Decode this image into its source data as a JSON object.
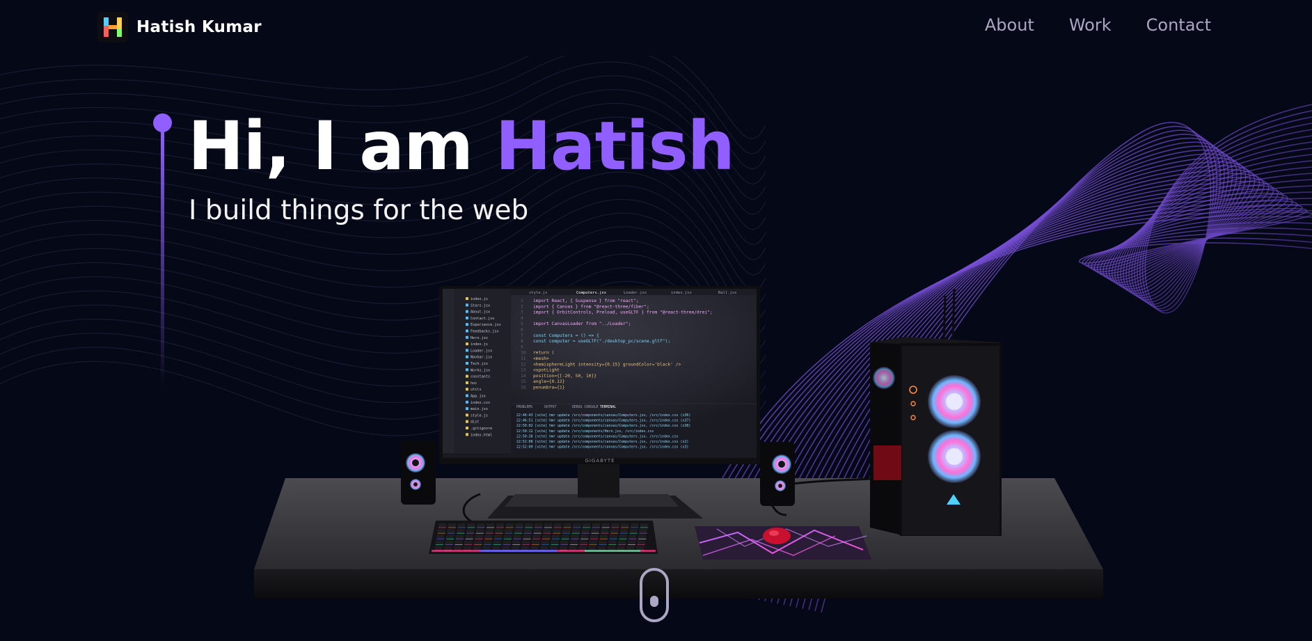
{
  "navbar": {
    "brand_name": "Hatish Kumar",
    "logo_letter": "H",
    "links": [
      "About",
      "Work",
      "Contact"
    ]
  },
  "hero": {
    "greeting": "Hi, I am ",
    "name": "Hatish",
    "subtitle": "I build things for the web"
  },
  "scene": {
    "monitor_brand": "GIGABYTE",
    "code_lines": [
      "import React, { Suspense } from \"react\";",
      "import { Canvas } from \"@react-three/fiber\";",
      "import { OrbitControls, Preload, useGLTF } from \"@react-three/drei\";",
      "",
      "import CanvasLoader from \"../Loader\";",
      "",
      "const Computers = () => {",
      "  const computer = useGLTF(\"./desktop_pc/scene.gltf\");",
      "",
      "  return (",
      "    <mesh>",
      "      <hemisphereLight intensity={0.15} groundColor='black' />",
      "      <spotLight",
      "        position={[-20, 50, 10]}",
      "        angle={0.12}",
      "        penumbra={1}"
    ],
    "terminal_lines": [
      "22:46:43 [vite] hmr update /src/components/canvas/Computers.jsx, /src/index.css (x36)",
      "22:46:51 [vite] hmr update /src/components/canvas/Computers.jsx, /src/index.css (x37)",
      "22:50:02 [vite] hmr update /src/components/canvas/Computers.jsx, /src/index.css (x38)",
      "22:50:12 [vite] hmr update /src/components/Hero.jsx, /src/index.css",
      "22:50:38 [vite] hmr update /src/components/canvas/Computers.jsx, /src/index.css",
      "22:52:08 [vite] hmr update /src/components/canvas/Computers.jsx, /src/index.css (x2)",
      "22:52:09 [vite] hmr update /src/components/canvas/Computers.jsx, /src/index.css (x3)"
    ],
    "editor_tabs": [
      "style.js",
      "Computers.jsx",
      "Loader.jsx",
      "index.jsx",
      "Ball.jsx"
    ],
    "explorer_files": [
      "index.js",
      "Stars.jsx",
      "About.jsx",
      "Contact.jsx",
      "Experience.jsx",
      "Feedbacks.jsx",
      "Hero.jsx",
      "index.js",
      "Loader.jsx",
      "Navbar.jsx",
      "Tech.jsx",
      "Works.jsx",
      "constants",
      "hoc",
      "utils",
      "App.jsx",
      "index.css",
      "main.jsx",
      "style.js",
      "dist",
      ".gitignore",
      "index.html"
    ],
    "panel_tabs": [
      "PROBLEMS",
      "OUTPUT",
      "DEBUG CONSOLE",
      "TERMINAL"
    ]
  },
  "colors": {
    "background": "#050816",
    "accent": "#915eff",
    "nav_text": "#aaa6c3"
  }
}
